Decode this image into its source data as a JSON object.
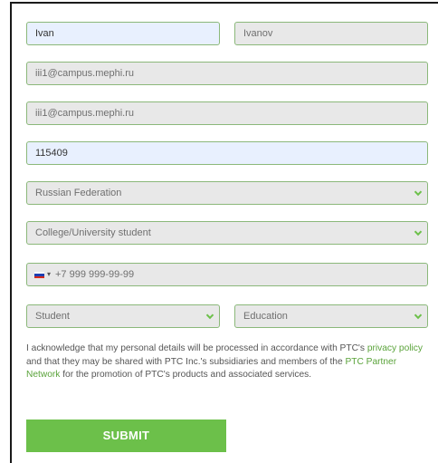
{
  "form": {
    "first_name": "Ivan",
    "last_name": "Ivanov",
    "email": "iii1@campus.mephi.ru",
    "email_confirm": "iii1@campus.mephi.ru",
    "postal_code": "115409",
    "country": "Russian Federation",
    "status": "College/University student",
    "phone_country_arrow": "▾",
    "phone": "+7 999 999-99-99",
    "role": "Student",
    "industry": "Education"
  },
  "consent": {
    "part1": "I acknowledge that my personal details will be processed in accordance with PTC's ",
    "privacy_link": "privacy policy",
    "part2": " and that they may be shared with PTC Inc.'s subsidiaries and members of the ",
    "partner_link": "PTC Partner Network",
    "part3": " for the promotion of PTC's products and associated services."
  },
  "submit_label": "SUBMIT",
  "colors": {
    "accent": "#6cc04a",
    "field_border": "#8bb87a",
    "autofill_bg": "#e8f0fe",
    "field_bg": "#e8e8e8"
  },
  "icons": {
    "select_arrow": "chevron-down-icon",
    "phone_flag": "russia-flag-icon"
  }
}
